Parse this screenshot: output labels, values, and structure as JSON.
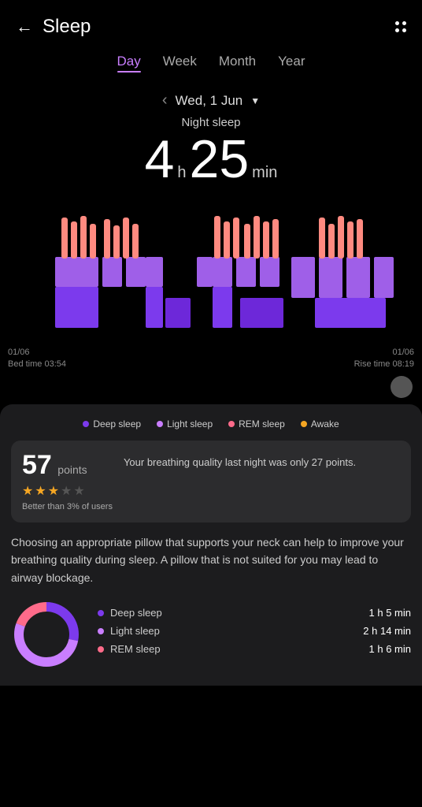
{
  "header": {
    "back_label": "←",
    "title": "Sleep",
    "menu_icon": "more-options-icon"
  },
  "tabs": [
    {
      "label": "Day",
      "active": true
    },
    {
      "label": "Week",
      "active": false
    },
    {
      "label": "Month",
      "active": false
    },
    {
      "label": "Year",
      "active": false
    }
  ],
  "date": {
    "text": "Wed, 1 Jun",
    "dropdown_arrow": "▼"
  },
  "sleep": {
    "label": "Night sleep",
    "hours": "4",
    "h_unit": "h",
    "minutes": "25",
    "min_unit": "min"
  },
  "chart_times": {
    "left_date": "01/06",
    "left_label": "Bed time 03:54",
    "right_date": "01/06",
    "right_label": "Rise time 08:19"
  },
  "legend": [
    {
      "label": "Deep sleep",
      "color": "#7c3aed"
    },
    {
      "label": "Light sleep",
      "color": "#c97eff"
    },
    {
      "label": "REM sleep",
      "color": "#ff6b8a"
    },
    {
      "label": "Awake",
      "color": "#f5a623"
    }
  ],
  "score": {
    "points": "57",
    "points_label": "points",
    "stars": [
      true,
      true,
      true,
      false,
      false
    ],
    "better_than": "Better than 3% of users",
    "description": "Your breathing quality last night was only 27 points."
  },
  "advice": "Choosing an appropriate pillow that supports your neck can help to improve your breathing quality during sleep. A pillow that is not suited for you may lead to airway blockage.",
  "breakdown": [
    {
      "label": "Deep sleep",
      "color": "#7c3aed",
      "time": "1 h 5 min"
    },
    {
      "label": "Light sleep",
      "color": "#c97eff",
      "time": "2 h 14 min"
    },
    {
      "label": "REM sleep",
      "color": "#ff6b8a",
      "time": "1 h 6 min"
    }
  ]
}
